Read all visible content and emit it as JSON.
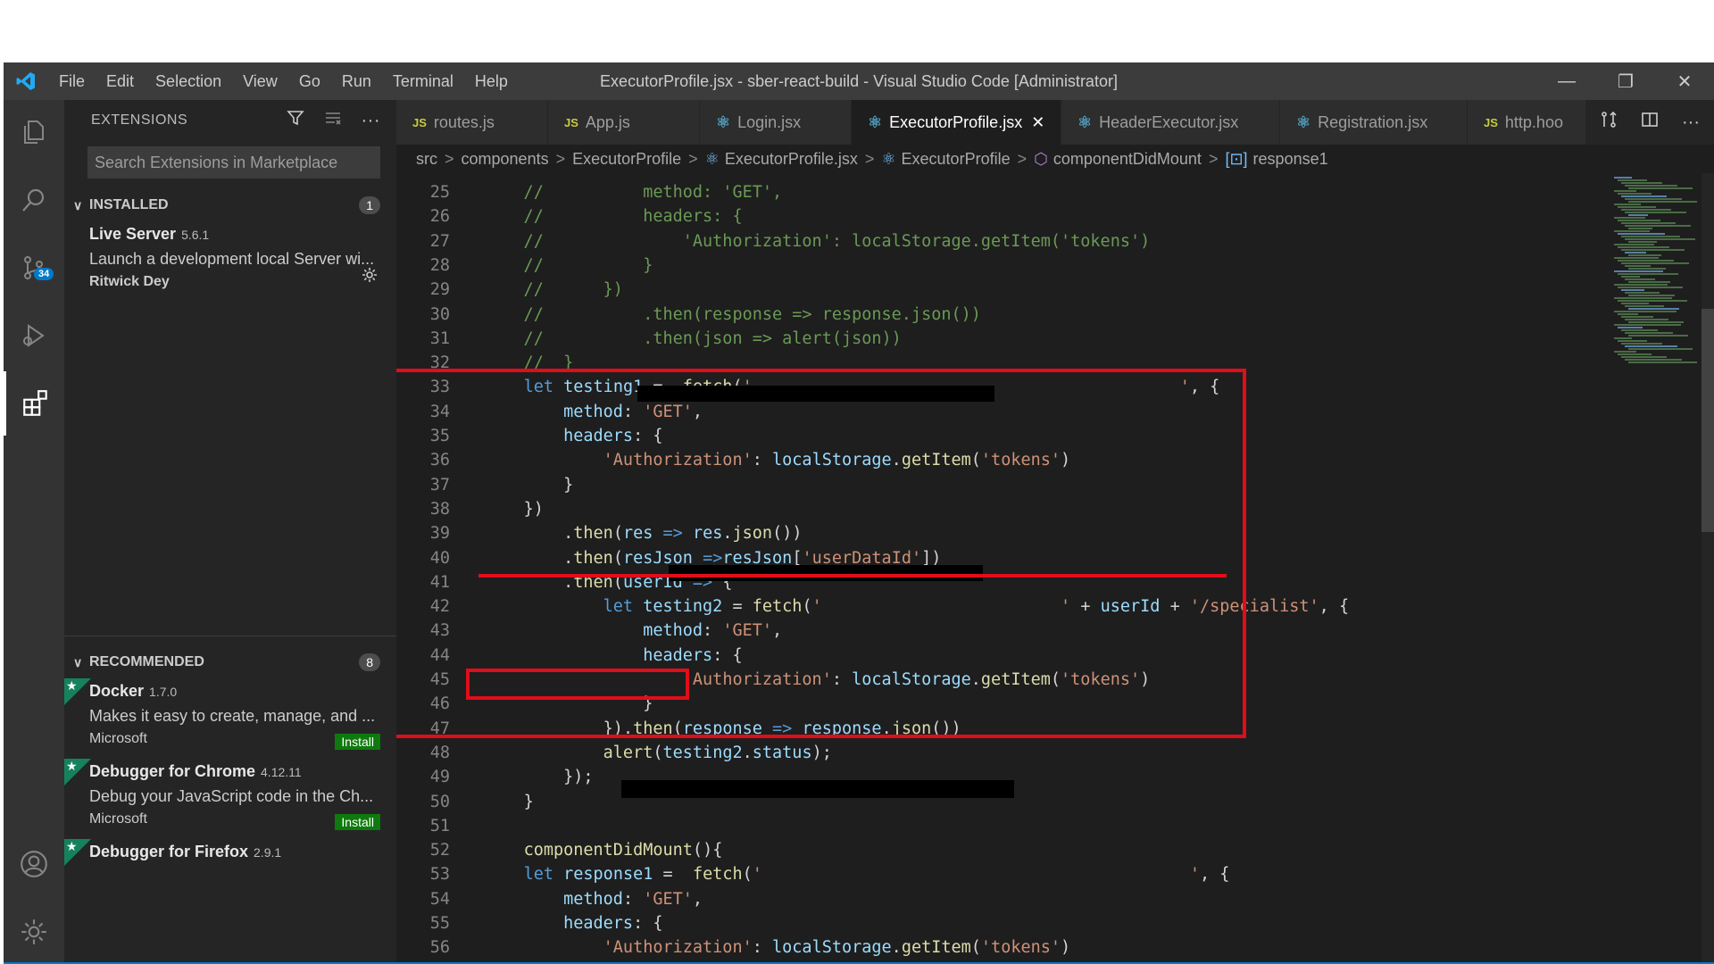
{
  "window_title": "ExecutorProfile.jsx - sber-react-build - Visual Studio Code [Administrator]",
  "menu": [
    "File",
    "Edit",
    "Selection",
    "View",
    "Go",
    "Run",
    "Terminal",
    "Help"
  ],
  "window_controls": {
    "minimize": "—",
    "restore": "❐",
    "close": "✕"
  },
  "activity": {
    "scm_badge": "34"
  },
  "sidebar": {
    "title": "EXTENSIONS",
    "search_placeholder": "Search Extensions in Marketplace",
    "installed": {
      "label": "INSTALLED",
      "count": "1",
      "items": [
        {
          "name": "Live Server",
          "version": "5.6.1",
          "desc": "Launch a development local Server wi...",
          "publisher": "Ritwick Dey"
        }
      ]
    },
    "recommended": {
      "label": "RECOMMENDED",
      "count": "8",
      "items": [
        {
          "name": "Docker",
          "version": "1.7.0",
          "desc": "Makes it easy to create, manage, and ...",
          "publisher": "Microsoft",
          "action": "Install"
        },
        {
          "name": "Debugger for Chrome",
          "version": "4.12.11",
          "desc": "Debug your JavaScript code in the Ch...",
          "publisher": "Microsoft",
          "action": "Install"
        },
        {
          "name": "Debugger for Firefox",
          "version": "2.9.1"
        }
      ]
    }
  },
  "tabs": [
    {
      "label": "routes.js",
      "icon": "JS"
    },
    {
      "label": "App.js",
      "icon": "JS"
    },
    {
      "label": "Login.jsx",
      "icon": "react"
    },
    {
      "label": "ExecutorProfile.jsx",
      "icon": "react",
      "active": true
    },
    {
      "label": "HeaderExecutor.jsx",
      "icon": "react"
    },
    {
      "label": "Registration.jsx",
      "icon": "react"
    },
    {
      "label": "http.hoo",
      "icon": "JS"
    }
  ],
  "breadcrumb": [
    "src",
    "components",
    "ExecutorProfile",
    "ExecutorProfile.jsx",
    "ExecutorProfile",
    "componentDidMount",
    "response1"
  ],
  "code_lines": [
    {
      "n": "25",
      "text": "    //          method: 'GET',"
    },
    {
      "n": "26",
      "text": "    //          headers: {"
    },
    {
      "n": "27",
      "text": "    //              'Authorization': localStorage.getItem('tokens')"
    },
    {
      "n": "28",
      "text": "    //          }"
    },
    {
      "n": "29",
      "text": "    //      })"
    },
    {
      "n": "30",
      "text": "    //          .then(response => response.json())"
    },
    {
      "n": "31",
      "text": "    //          .then(json => alert(json))"
    },
    {
      "n": "32",
      "text": "    //  }"
    },
    {
      "n": "33",
      "text": "    let testing1 =  fetch('                                           ', {"
    },
    {
      "n": "34",
      "text": "        method: 'GET',"
    },
    {
      "n": "35",
      "text": "        headers: {"
    },
    {
      "n": "36",
      "text": "            'Authorization': localStorage.getItem('tokens')"
    },
    {
      "n": "37",
      "text": "        }"
    },
    {
      "n": "38",
      "text": "    })"
    },
    {
      "n": "39",
      "text": "        .then(res => res.json())"
    },
    {
      "n": "40",
      "text": "        .then(resJson =>resJson['userDataId'])"
    },
    {
      "n": "41",
      "text": "        .then(userId => {"
    },
    {
      "n": "42",
      "text": "            let testing2 = fetch('                        ' + userId + '/specialist', {"
    },
    {
      "n": "43",
      "text": "                method: 'GET',"
    },
    {
      "n": "44",
      "text": "                headers: {"
    },
    {
      "n": "45",
      "text": "                    'Authorization': localStorage.getItem('tokens')"
    },
    {
      "n": "46",
      "text": "                }"
    },
    {
      "n": "47",
      "text": "            }).then(response => response.json())"
    },
    {
      "n": "48",
      "text": "            alert(testing2.status);"
    },
    {
      "n": "49",
      "text": "        });"
    },
    {
      "n": "50",
      "text": "    }"
    },
    {
      "n": "51",
      "text": ""
    },
    {
      "n": "52",
      "text": "    componentDidMount(){"
    },
    {
      "n": "53",
      "text": "    let response1 =  fetch('                                           ', {"
    },
    {
      "n": "54",
      "text": "        method: 'GET',"
    },
    {
      "n": "55",
      "text": "        headers: {"
    },
    {
      "n": "56",
      "text": "            'Authorization': localStorage.getItem('tokens')"
    }
  ]
}
